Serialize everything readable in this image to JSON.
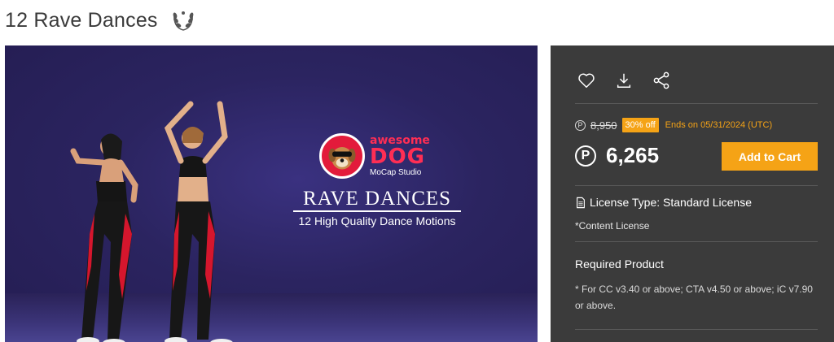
{
  "page": {
    "title": "12 Rave Dances",
    "title_icon": "laurel-wreath-icon"
  },
  "hero": {
    "brand_word1": "awesome",
    "brand_word2": "DOG",
    "brand_word3": "MoCap Studio",
    "heading": "RAVE DANCES",
    "subheading": "12 High Quality Dance Motions",
    "background_color": "#2a2258"
  },
  "actions": [
    {
      "icon": "heart-icon"
    },
    {
      "icon": "download-icon"
    },
    {
      "icon": "share-icon"
    }
  ],
  "pricing": {
    "currency_symbol": "P",
    "old_price": "8,950",
    "discount": "30% off",
    "ends": "Ends on 05/31/2024 (UTC)",
    "price": "6,265",
    "add_to_cart": "Add to Cart",
    "accent_color": "#f5a316"
  },
  "license": {
    "label": "License Type: Standard License",
    "sub": "*Content License"
  },
  "required": {
    "title": "Required Product",
    "text": "* For CC v3.40 or above; CTA v4.50 or above; iC v7.90 or above."
  }
}
